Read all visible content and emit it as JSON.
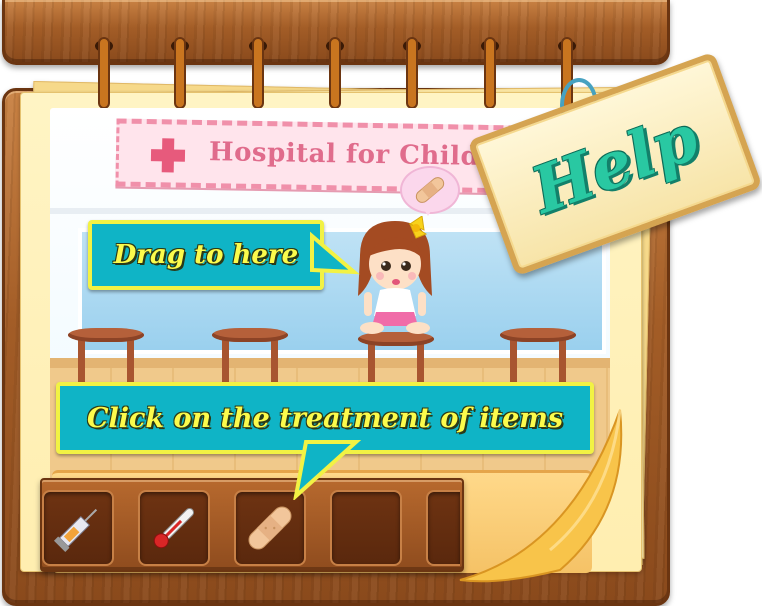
{
  "game": {
    "banner_title": "Hospital for Children",
    "help_label": "Help",
    "callouts": {
      "drag_hint": "Drag to here",
      "click_hint": "Click on the treatment of items"
    },
    "items": [
      {
        "name": "syringe",
        "icon": "syringe-icon"
      },
      {
        "name": "thermometer",
        "icon": "thermometer-icon"
      },
      {
        "name": "bandage",
        "icon": "bandage-icon"
      },
      {
        "name": "empty",
        "icon": ""
      },
      {
        "name": "empty",
        "icon": ""
      }
    ]
  },
  "colors": {
    "callout_bg": "#0fb4c6",
    "callout_text": "#fbfb4c",
    "help_text": "#29c8a2",
    "wood": "#a35d27",
    "paper": "#fff4c4"
  }
}
